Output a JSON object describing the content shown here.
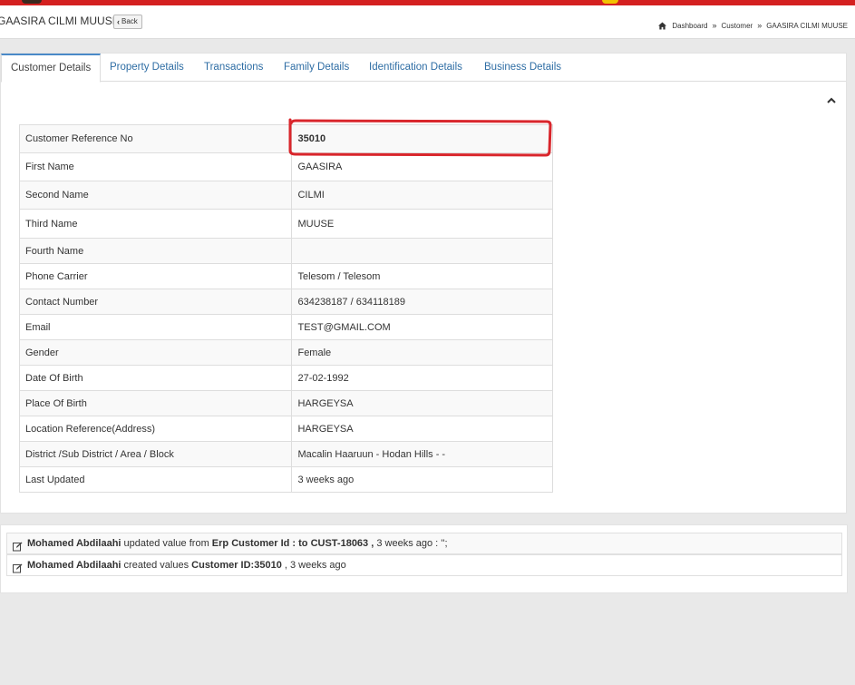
{
  "header": {
    "title": "GAASIRA CILMI MUUSE",
    "back_label": "Back",
    "breadcrumb": [
      "Dashboard",
      "Customer",
      "GAASIRA CILMI MUUSE"
    ],
    "breadcrumb_separator": "»"
  },
  "tabs": [
    {
      "label": "Customer Details",
      "active": true
    },
    {
      "label": "Property Details",
      "active": false
    },
    {
      "label": "Transactions",
      "active": false
    },
    {
      "label": "Family Details",
      "active": false
    },
    {
      "label": "Identification Details",
      "active": false
    },
    {
      "label": "Business Details",
      "active": false
    }
  ],
  "details": [
    {
      "label": "Customer Reference No",
      "value": "35010"
    },
    {
      "label": "First Name",
      "value": "GAASIRA"
    },
    {
      "label": "Second Name",
      "value": "CILMI"
    },
    {
      "label": "Third Name",
      "value": "MUUSE"
    },
    {
      "label": "Fourth Name",
      "value": ""
    },
    {
      "label": "Phone Carrier",
      "value": "Telesom / Telesom"
    },
    {
      "label": "Contact Number",
      "value": "634238187 / 634118189"
    },
    {
      "label": "Email",
      "value": "TEST@GMAIL.COM"
    },
    {
      "label": "Gender",
      "value": "Female"
    },
    {
      "label": "Date Of Birth",
      "value": "27-02-1992"
    },
    {
      "label": "Place Of Birth",
      "value": "HARGEYSA"
    },
    {
      "label": "Location Reference(Address)",
      "value": "HARGEYSA"
    },
    {
      "label": "District /Sub District / Area / Block",
      "value": "Macalin Haaruun - Hodan Hills - -"
    },
    {
      "label": "Last Updated",
      "value": "3 weeks ago"
    }
  ],
  "activity": [
    {
      "user": "Mohamed Abdilaahi",
      "action": " updated value from ",
      "field": "Erp Customer Id : to CUST-18063 ,",
      "time": " 3 weeks ago : '';"
    },
    {
      "user": "Mohamed Abdilaahi",
      "action": " created values ",
      "field": "Customer ID:35010",
      "time": " , 3 weeks ago"
    }
  ],
  "colors": {
    "topbar": "#d42020",
    "tab_link": "#2e6da4",
    "annotation": "#d9262c"
  },
  "icons": [
    "home-icon",
    "chevron-left-icon",
    "chevron-up-icon",
    "edit-icon"
  ]
}
